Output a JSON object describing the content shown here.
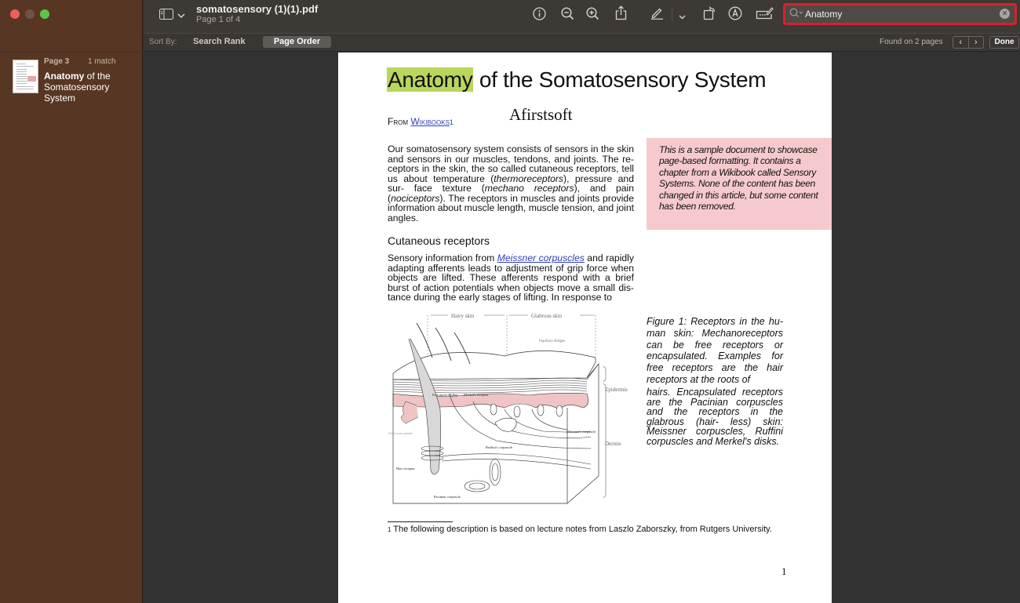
{
  "window": {
    "traffic_lights": [
      "close",
      "minimize",
      "zoom"
    ]
  },
  "sidebar": {
    "results": [
      {
        "page": "Page 3",
        "matches": "1 match",
        "match_word": "Anatomy",
        "rest": " of the Somatosensory System"
      }
    ]
  },
  "toolbar": {
    "sidebar_toggle_icon": "sidebar-icon",
    "title": "somatosensory (1)(1).pdf",
    "subtitle": "Page 1 of 4",
    "icons": [
      "info-icon",
      "zoom-out-icon",
      "zoom-in-icon",
      "share-icon",
      "markup-pen-icon",
      "chevron-down-icon",
      "rotate-icon",
      "annotate-icon",
      "form-fill-icon"
    ],
    "search": {
      "value": "Anatomy",
      "highlight_color": "#d8202f"
    }
  },
  "search_bar": {
    "sort_label": "Sort By:",
    "sort_options": [
      "Search Rank",
      "Page Order"
    ],
    "sort_selected": "Page Order",
    "found_text": "Found on 2 pages",
    "prev": "‹",
    "next": "›",
    "done": "Done"
  },
  "document": {
    "title_highlight": "Anatomy",
    "title_rest": " of the Somatosensory System",
    "from_label": "From",
    "from_link": "Wikibooks",
    "from_footnote_ref": "1",
    "author": "Afirstsoft",
    "para1": [
      "Our somatosensory system consists of sensors in the skin and sensors in our muscles, tendons, and joints. The re- ceptors in the skin, the so called cutaneous receptors, tell us about temperature (",
      "thermoreceptors",
      "), pressure and sur- face texture (",
      "mechano receptors",
      "), and pain (",
      "nociceptors",
      "). The receptors in muscles and joints provide information about muscle length, muscle tension, and joint angles."
    ],
    "heading2": "Cutaneous receptors",
    "para2_pre": "Sensory information from ",
    "para2_link": "Meissner corpuscles",
    "para2_post": " and rapidly adapting afferents leads to adjustment of grip force when objects are lifted. These afferents respond with a brief burst of action potentials when objects move a small dis- tance during the early stages of lifting. In response to",
    "note": "This is a sample document to showcase page-based formatting. It contains a chapter from a Wikibook called Sensory Systems. None of the content has been changed in this article, but some content has been removed.",
    "caption_part1": "Figure 1: Receptors in the hu- man skin: Mechanoreceptors can be free receptors or encapsulated. Examples for free receptors are the hair receptors at the roots of",
    "caption_part2": "hairs. Encapsulated receptors are the Pacinian corpuscles and the receptors in the glabrous (hair- less) skin: Meissner corpuscles, Ruffini corpuscles and Merkel's disks.",
    "figure_labels": {
      "hairy": "Hairy skin",
      "glabrous": "Glabrous skin",
      "papillary": "Papillary Ridges",
      "epidermis": "Epidermis",
      "dermis": "Dermis",
      "free_nerve": "Free nerve ending",
      "merkel": "Merkel's receptor",
      "sebaceous": "Sebaceous gland",
      "ruffini": "Ruffini's corpuscle",
      "meissner": "Meissner's corpuscle",
      "hair_receptor": "Hair receptor",
      "pacinian": "Pacinian corpuscle"
    },
    "footnote_num": "1",
    "footnote": " The following description is based on lecture notes from Laszlo Zaborszky, from Rutgers University.",
    "page_number": "1"
  }
}
